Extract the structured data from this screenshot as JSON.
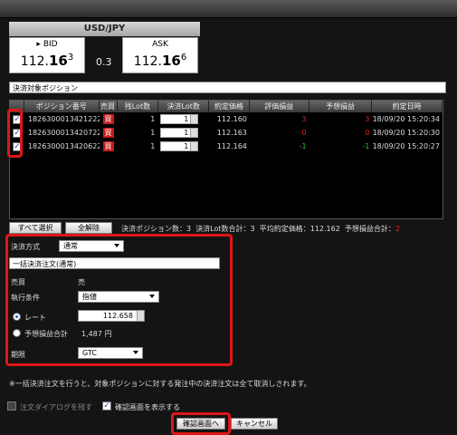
{
  "pair": "USD/JPY",
  "bid": {
    "label": "BID",
    "big": "112.",
    "mid": "16",
    "small": "3"
  },
  "ask": {
    "label": "ASK",
    "big": "112.",
    "mid": "16",
    "small": "6"
  },
  "spread": "0.3",
  "positions_title": "決済対象ポジション",
  "columns": [
    "ポジション番号",
    "売買",
    "残Lot数",
    "決済Lot数",
    "約定価格",
    "評価損益",
    "予想損益",
    "約定日時"
  ],
  "rows": [
    {
      "id": "1826300013421222",
      "side": "買",
      "remain": "1",
      "lot": "1",
      "price": "112.160",
      "eval": "3",
      "exp": "3",
      "time": "18/09/20 15:20:34",
      "eval_color": "#e02020",
      "exp_color": "#e02020"
    },
    {
      "id": "1826300013420722",
      "side": "買",
      "remain": "1",
      "lot": "1",
      "price": "112.163",
      "eval": "0",
      "exp": "0",
      "time": "18/09/20 15:20:30",
      "eval_color": "#e02020",
      "exp_color": "#e02020"
    },
    {
      "id": "1826300013420622",
      "side": "買",
      "remain": "1",
      "lot": "1",
      "price": "112.164",
      "eval": "-1",
      "exp": "-1",
      "time": "18/09/20 15:20:27",
      "eval_color": "#2ec42e",
      "exp_color": "#2ec42e"
    }
  ],
  "select_all": "すべて選択",
  "deselect_all": "全解除",
  "summary": {
    "count_label": "決済ポジション数：",
    "count": "3",
    "lot_label": "決済Lot数合計：",
    "lot": "3",
    "avg_label": "平均約定価格：",
    "avg": "112.162",
    "pl_label": "予想損益合計：",
    "pl": "2"
  },
  "method_label": "決済方式",
  "method_value": "通常",
  "order_bar": "一括決済注文(通常)",
  "side_label": "売買",
  "side_value": "売",
  "exec_label": "執行条件",
  "exec_value": "指値",
  "rate_label": "レート",
  "rate_value": "112.658",
  "pl_label": "予想損益合計",
  "pl_value": "1,487 円",
  "expiry_label": "期限",
  "expiry_value": "GTC",
  "notice": "※一括決済注文を行うと、対象ポジションに対する発注中の決済注文は全て取消しされます。",
  "keep_dialog": "注文ダイアログを残す",
  "show_confirm": "確認画面を表示する",
  "confirm_button": "確認画面へ",
  "cancel_button": "キャンセル",
  "check": "✓"
}
